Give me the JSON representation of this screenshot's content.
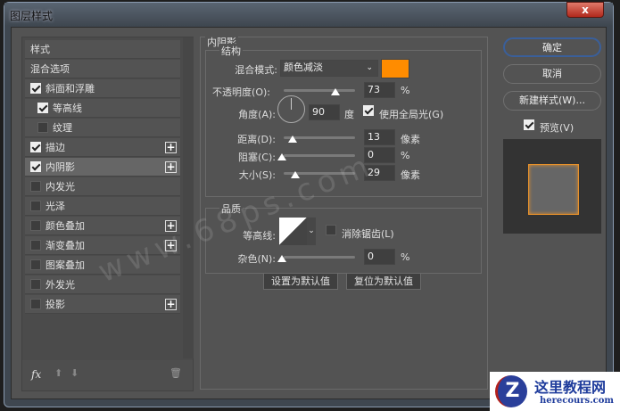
{
  "window": {
    "title": "图层样式",
    "close": "x"
  },
  "sidebar": {
    "items": [
      {
        "label": "样式",
        "checkbox": null,
        "plus": false
      },
      {
        "label": "混合选项",
        "checkbox": null,
        "plus": false
      },
      {
        "label": "斜面和浮雕",
        "checkbox": true,
        "plus": false
      },
      {
        "label": "等高线",
        "checkbox": true,
        "plus": false,
        "indent": true
      },
      {
        "label": "纹理",
        "checkbox": false,
        "plus": false,
        "indent": true
      },
      {
        "label": "描边",
        "checkbox": true,
        "plus": true
      },
      {
        "label": "内阴影",
        "checkbox": true,
        "plus": true,
        "selected": true
      },
      {
        "label": "内发光",
        "checkbox": false,
        "plus": false
      },
      {
        "label": "光泽",
        "checkbox": false,
        "plus": false
      },
      {
        "label": "颜色叠加",
        "checkbox": false,
        "plus": true
      },
      {
        "label": "渐变叠加",
        "checkbox": false,
        "plus": true
      },
      {
        "label": "图案叠加",
        "checkbox": false,
        "plus": false
      },
      {
        "label": "外发光",
        "checkbox": false,
        "plus": false
      },
      {
        "label": "投影",
        "checkbox": false,
        "plus": true
      }
    ],
    "fx": "fx"
  },
  "panel": {
    "title": "内阴影",
    "structure": {
      "title": "结构",
      "blend_label": "混合模式:",
      "blend_value": "颜色减淡",
      "color": "#ff8c00",
      "opacity_label": "不透明度(O):",
      "opacity": "73",
      "opacity_unit": "%",
      "angle_label": "角度(A):",
      "angle": "90",
      "angle_unit": "度",
      "global_light": "使用全局光(G)",
      "distance_label": "距离(D):",
      "distance": "13",
      "distance_unit": "像素",
      "choke_label": "阻塞(C):",
      "choke": "0",
      "choke_unit": "%",
      "size_label": "大小(S):",
      "size": "29",
      "size_unit": "像素"
    },
    "quality": {
      "title": "品质",
      "contour_label": "等高线:",
      "antialias": "消除锯齿(L)",
      "noise_label": "杂色(N):",
      "noise": "0",
      "noise_unit": "%"
    },
    "set_default": "设置为默认值",
    "reset_default": "复位为默认值"
  },
  "actions": {
    "ok": "确定",
    "cancel": "取消",
    "new_style": "新建样式(W)...",
    "preview": "预览(V)"
  },
  "watermark": "www.68ps.com",
  "logo": {
    "name": "这里教程网",
    "url": "herecours.com"
  }
}
